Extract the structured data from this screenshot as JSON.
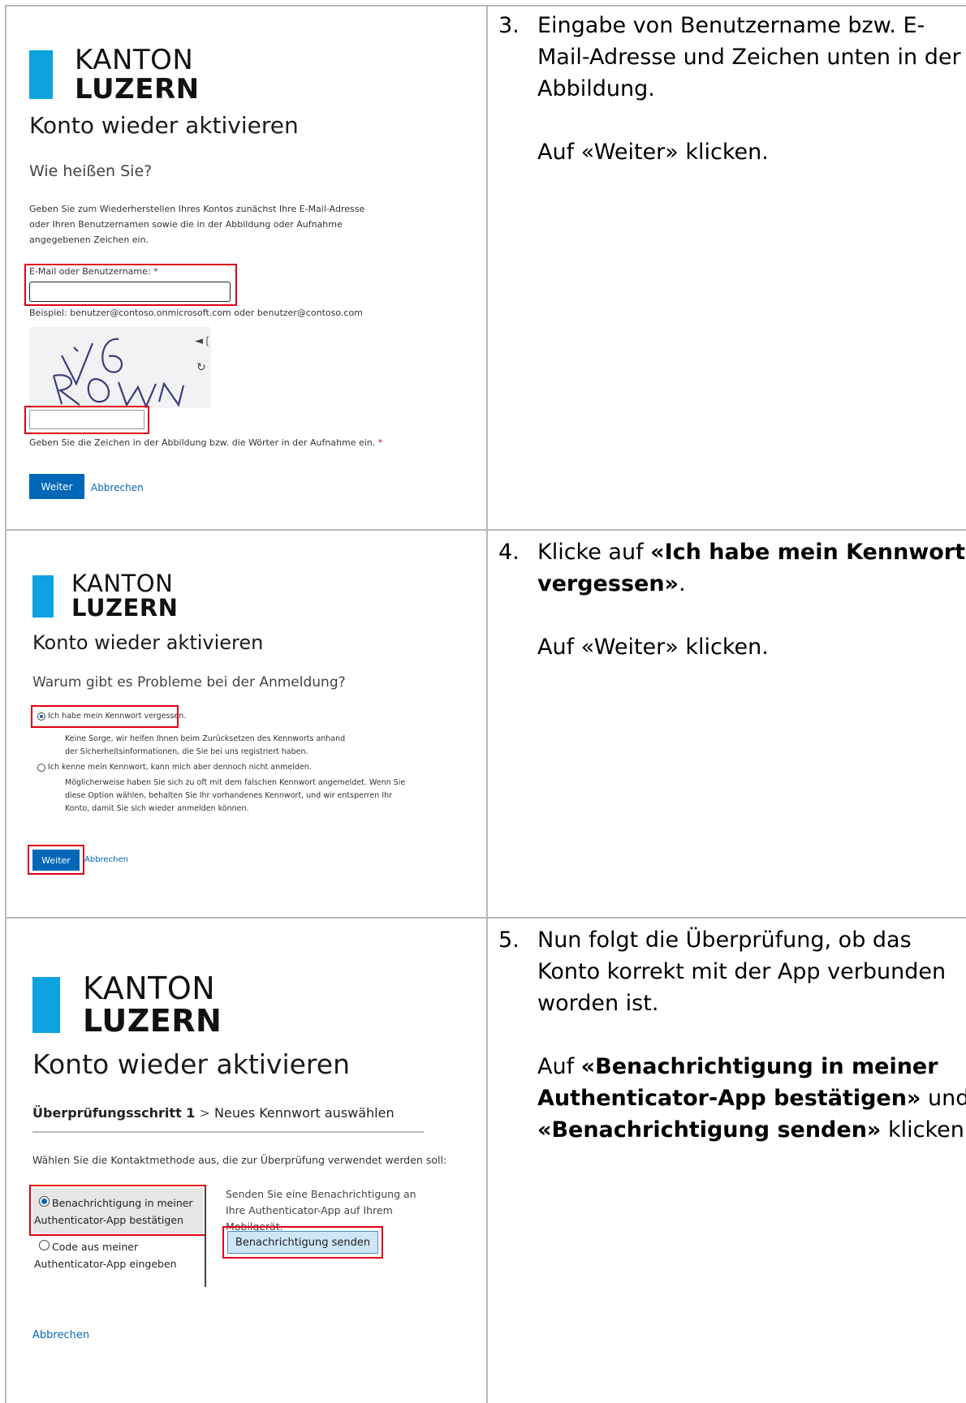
{
  "brand": {
    "line1": "KANTON",
    "line2": "LUZERN",
    "color": "#0ea2e0"
  },
  "step3": {
    "number": "3.",
    "text": "Eingabe von Benutzername bzw. E-Mail-Adresse und Zeichen unten in der Abbildung.",
    "action": "Auf «Weiter» klicken.",
    "screen": {
      "title": "Konto wieder aktivieren",
      "subtitle": "Wie heißen Sie?",
      "intro": "Geben Sie zum Wiederherstellen Ihres Kontos zunächst Ihre E-Mail-Adresse oder Ihren Benutzernamen sowie die in der Abbildung oder Aufnahme angegebenen Zeichen ein.",
      "email_label": "E-Mail oder Benutzername: *",
      "email_value": "",
      "email_hint": "Beispiel: benutzer@contoso.onmicrosoft.com oder benutzer@contoso.com",
      "captcha_text": "V6RDWN",
      "captcha_value": "",
      "captcha_hint": "Geben Sie die Zeichen in der Abbildung bzw. die Wörter in der Aufnahme ein.",
      "captcha_required": "*",
      "next_label": "Weiter",
      "cancel_label": "Abbrechen"
    }
  },
  "step4": {
    "number": "4.",
    "text_prefix": "Klicke auf ",
    "text_bold": "«Ich habe mein Kennwort vergessen»",
    "text_suffix": ".",
    "action": "Auf «Weiter» klicken.",
    "screen": {
      "title": "Konto wieder aktivieren",
      "subtitle": "Warum gibt es Probleme bei der Anmeldung?",
      "option1_label": "Ich habe mein Kennwort vergessen.",
      "option1_desc": "Keine Sorge, wir helfen Ihnen beim Zurücksetzen des Kennworts anhand der Sicherheitsinformationen, die Sie bei uns registriert haben.",
      "option2_label": "Ich kenne mein Kennwort, kann mich aber dennoch nicht anmelden.",
      "option2_desc": "Möglicherweise haben Sie sich zu oft mit dem falschen Kennwort angemeldet. Wenn Sie diese Option wählen, behalten Sie Ihr vorhandenes Kennwort, und wir entsperren Ihr Konto, damit Sie sich wieder anmelden können.",
      "next_label": "Weiter",
      "cancel_label": "Abbrechen"
    }
  },
  "step5": {
    "number": "5.",
    "text": "Nun folgt die Überprüfung, ob das Konto korrekt mit der App verbunden worden ist.",
    "action_prefix": "Auf ",
    "action_bold1": "«Benachrichtigung in meiner Authenticator-App bestätigen»",
    "action_mid": " und ",
    "action_bold2": "«Benachrichtigung senden»",
    "action_suffix": " klicken.",
    "screen": {
      "title": "Konto wieder aktivieren",
      "breadcrumb_current": "Überprüfungsschritt 1",
      "breadcrumb_sep": ">",
      "breadcrumb_next": "Neues Kennwort auswählen",
      "instruction": "Wählen Sie die Kontaktmethode aus, die zur Überprüfung verwendet werden soll:",
      "option1_label": "Benachrichtigung in meiner Authenticator-App bestätigen",
      "option2_label": "Code aus meiner Authenticator-App eingeben",
      "side_text": "Senden Sie eine Benachrichtigung an Ihre Authenticator-App auf Ihrem Mobilgerät.",
      "send_label": "Benachrichtigung senden",
      "cancel_label": "Abbrechen"
    }
  }
}
